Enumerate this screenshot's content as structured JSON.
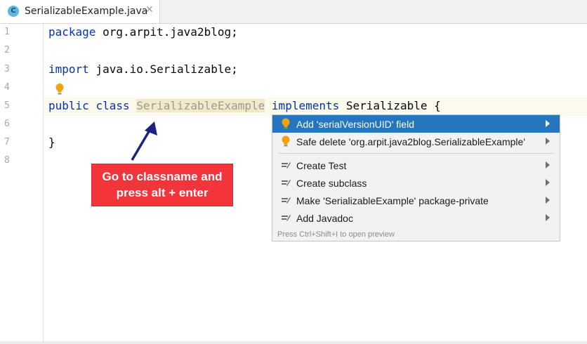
{
  "tab": {
    "icon_letter": "C",
    "filename": "SerializableExample.java",
    "close_glyph": "✕"
  },
  "line_numbers": [
    "1",
    "2",
    "3",
    "4",
    "5",
    "6",
    "7",
    "8"
  ],
  "code": {
    "line1_kw": "package",
    "line1_rest": " org.arpit.java2blog;",
    "line3_kw": "import",
    "line3_rest": " java.io.Serializable;",
    "line5_kw1": "public",
    "line5_kw2": "class",
    "line5_class": "SerializableExample",
    "line5_kw3": "implements",
    "line5_rest": " Serializable {",
    "line7": "}"
  },
  "callout": {
    "line1": "Go to classname and",
    "line2": "press alt + enter"
  },
  "intentions": {
    "items": [
      {
        "label": "Add 'serialVersionUID' field",
        "icon": "bulb-icon",
        "selected": true
      },
      {
        "label": "Safe delete 'org.arpit.java2blog.SerializableExample'",
        "icon": "bulb-icon",
        "selected": false
      },
      {
        "label": "Create Test",
        "icon": "edit-icon",
        "selected": false
      },
      {
        "label": "Create subclass",
        "icon": "edit-icon",
        "selected": false
      },
      {
        "label": "Make 'SerializableExample' package-private",
        "icon": "edit-icon",
        "selected": false
      },
      {
        "label": "Add Javadoc",
        "icon": "edit-icon",
        "selected": false
      }
    ],
    "footer": "Press Ctrl+Shift+I to open preview"
  },
  "colors": {
    "keyword": "#0033b3",
    "selection": "#2675bf",
    "callout": "#f2353a",
    "bulb": "#f0a30a"
  }
}
